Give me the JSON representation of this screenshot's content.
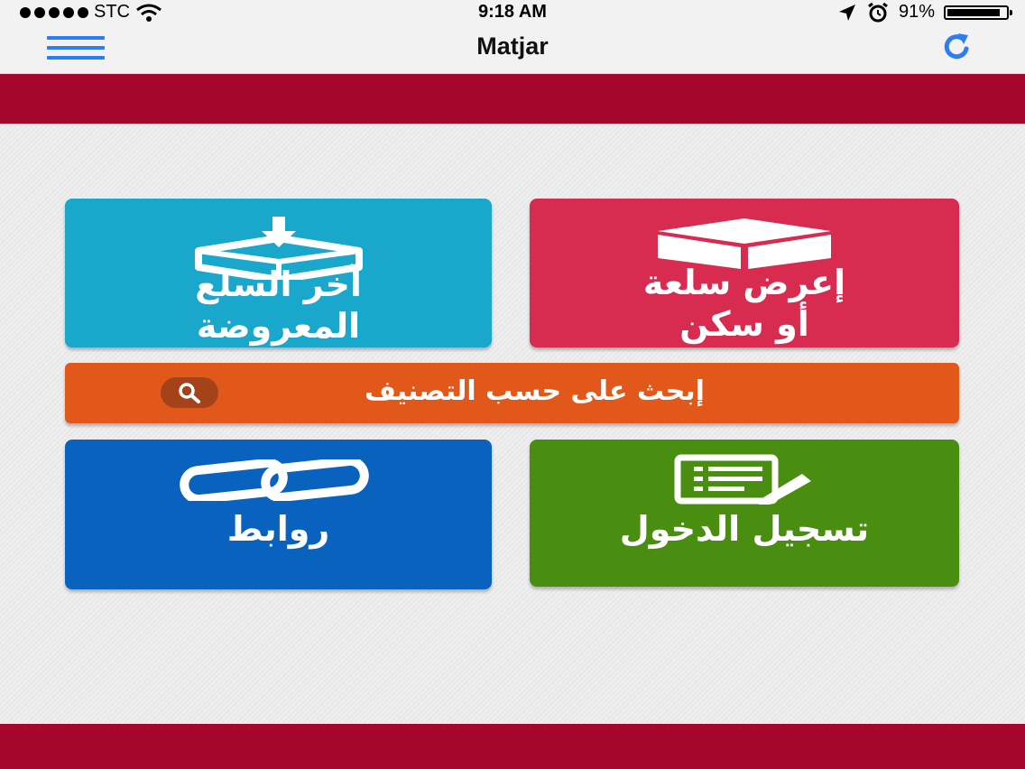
{
  "status_bar": {
    "carrier": "STC",
    "time": "9:18 AM",
    "battery_percent": "91%",
    "battery_level": 0.91,
    "icons": [
      "signal-dots-icon",
      "wifi-icon",
      "location-arrow-icon",
      "alarm-icon",
      "battery-icon"
    ]
  },
  "nav": {
    "title": "Matjar",
    "menu_icon": "hamburger-icon",
    "refresh_icon": "refresh-icon",
    "accent": "#2c7ef0"
  },
  "tiles": {
    "latest": {
      "label": "آخر السلع\nالمعروضة",
      "color": "#19a7cb",
      "icon": "box-download-icon"
    },
    "offer": {
      "label": "إعرض سلعة\nأو سكن",
      "color": "#d72b4f",
      "icon": "box-icon"
    },
    "links": {
      "label": "روابط",
      "color": "#0862be",
      "icon": "chain-link-icon"
    },
    "login": {
      "label": "تسجيل الدخول",
      "color": "#4a8e11",
      "icon": "form-pencil-icon"
    }
  },
  "search": {
    "label": "إبحث على حسب التصنيف",
    "color": "#e2581a",
    "icon": "search-icon"
  },
  "theme": {
    "band_color": "#a5062c"
  }
}
